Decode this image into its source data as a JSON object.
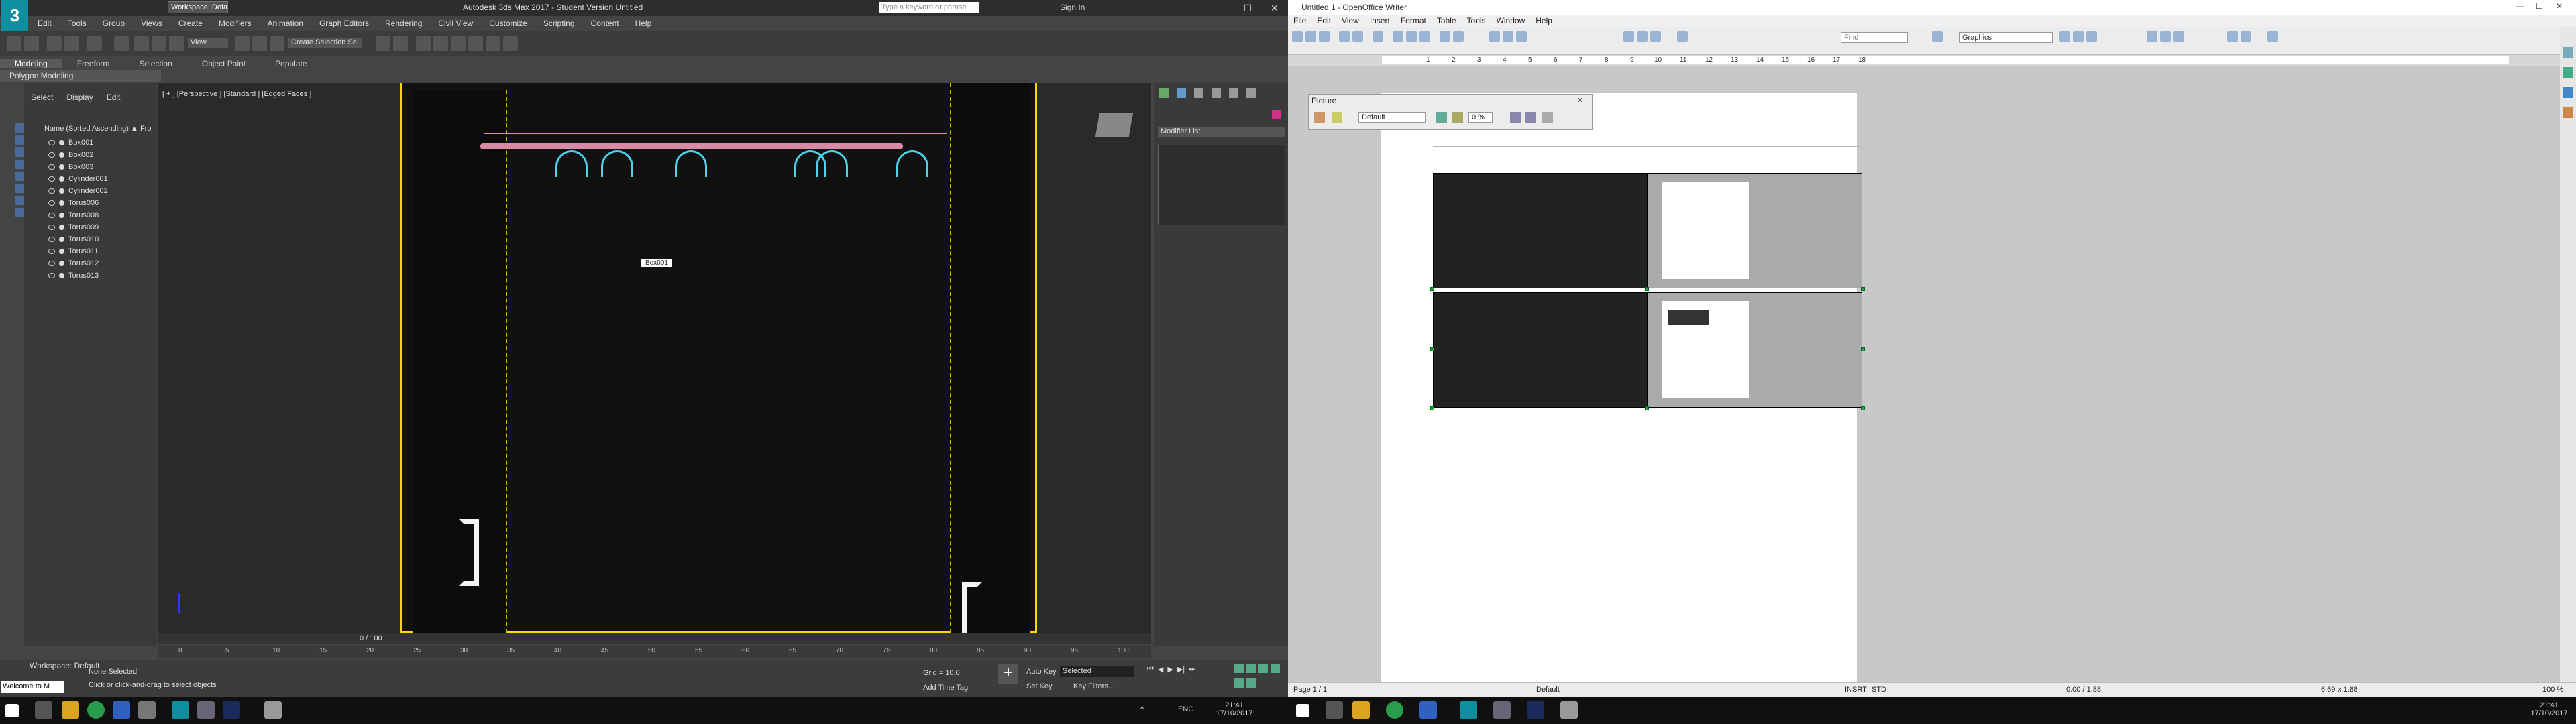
{
  "max": {
    "title": "Autodesk 3ds Max 2017 - Student Version   Untitled",
    "logo": "3",
    "workspace": "Workspace: Default",
    "search_placeholder": "Type a keyword or phrase",
    "sign_in": "Sign In",
    "menu": [
      "Edit",
      "Tools",
      "Group",
      "Views",
      "Create",
      "Modifiers",
      "Animation",
      "Graph Editors",
      "Rendering",
      "Civil View",
      "Customize",
      "Scripting",
      "Content",
      "Help"
    ],
    "ribbon_tabs": [
      "Modeling",
      "Freeform",
      "Selection",
      "Object Paint",
      "Populate"
    ],
    "ribbon_sub": "Polygon Modeling",
    "scene_tabs": [
      "Select",
      "Display",
      "Edit"
    ],
    "scene_header": "Name (Sorted Ascending)  ▲ Fro",
    "objects": [
      "Box001",
      "Box002",
      "Box003",
      "Cylinder001",
      "Cylinder002",
      "Torus006",
      "Torus008",
      "Torus009",
      "Torus010",
      "Torus011",
      "Torus012",
      "Torus013"
    ],
    "viewport_label": "[ + ] [Perspective ] [Standard ] [Edged Faces ]",
    "tooltip": "Box001",
    "modifier_list": "Modifier List",
    "time_label": "0 / 100",
    "ruler_ticks": [
      "0",
      "5",
      "10",
      "15",
      "20",
      "25",
      "30",
      "35",
      "40",
      "45",
      "50",
      "55",
      "60",
      "65",
      "70",
      "75",
      "80",
      "85",
      "90",
      "95",
      "100"
    ],
    "workspace_bottom": "Workspace: Default",
    "welcome": "Welcome to M",
    "none_selected": "None Selected",
    "hint": "Click or click-and-drag to select objects",
    "grid": "Grid = 10,0",
    "add_time_tag": "Add Time Tag",
    "auto_key": "Auto Key",
    "set_key": "Set Key",
    "selected": "Selected",
    "key_filters": "Key Filters...",
    "ws_default_dd": "View",
    "create_sel": "Create Selection Se"
  },
  "oo": {
    "title": "Untitled 1 - OpenOffice Writer",
    "menu": [
      "File",
      "Edit",
      "View",
      "Insert",
      "Format",
      "Table",
      "Tools",
      "Window",
      "Help"
    ],
    "find": "Find",
    "graphics": "Graphics",
    "ruler": [
      "1",
      "2",
      "3",
      "4",
      "5",
      "6",
      "7",
      "8",
      "9",
      "10",
      "11",
      "12",
      "13",
      "14",
      "15",
      "16",
      "17",
      "18"
    ],
    "picture_bar_title": "Picture",
    "picture_default": "Default",
    "picture_pct": "0 %",
    "status": {
      "page": "Page 1 / 1",
      "style": "Default",
      "insrt": "INSRT",
      "std": "STD",
      "pos": "0.00 / 1.88",
      "size": "6.69 x 1.88",
      "zoom": "100 %"
    }
  },
  "taskbar": {
    "lang": "ENG",
    "time_left": "21:41",
    "date_left": "17/10/2017",
    "time_right": "21:41",
    "date_right": "17/10/2017"
  },
  "colors": {
    "rail": "#d98aa7",
    "hanger": "#4dd0e8",
    "selection": "#ffd700"
  }
}
